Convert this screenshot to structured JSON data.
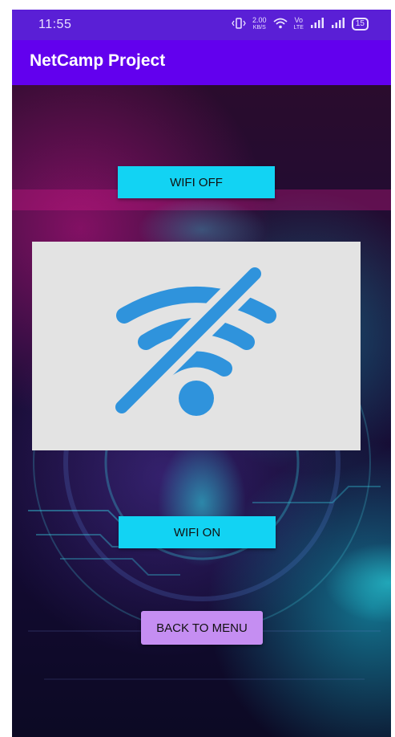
{
  "status_bar": {
    "time": "11:55",
    "data_speed": "2.00",
    "data_speed_unit": "KB/S",
    "volte_top": "Vo",
    "volte_bottom": "LTE",
    "battery": "15",
    "icons": [
      "vibrate-icon",
      "wifi-icon",
      "signal-icon",
      "signal-icon",
      "battery-icon"
    ]
  },
  "app_bar": {
    "title": "NetCamp Project"
  },
  "buttons": {
    "wifi_off": "WIFI OFF",
    "wifi_on": "WIFI ON",
    "back": "BACK TO MENU"
  },
  "image": {
    "icon": "wifi-off-icon",
    "icon_color": "#2f93dc",
    "background": "#e3e3e3"
  },
  "colors": {
    "status_bar": "#5a1fd6",
    "app_bar": "#6200ee",
    "button_cyan": "#12d3f3",
    "button_purple": "#c58ef2"
  }
}
